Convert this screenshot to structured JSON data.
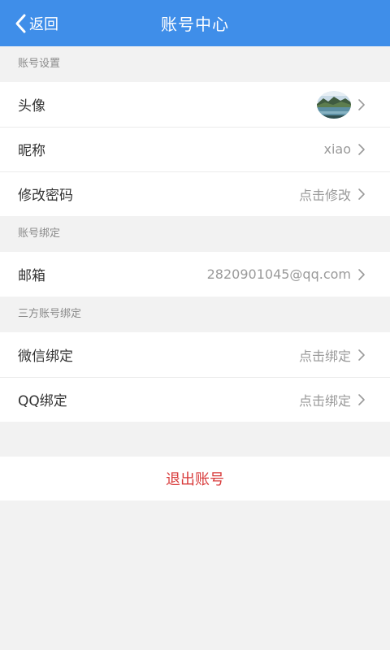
{
  "header": {
    "back_label": "返回",
    "title": "账号中心"
  },
  "colors": {
    "primary": "#3f8ee9",
    "logout": "#d83a3a"
  },
  "sections": {
    "account_settings": {
      "label": "账号设置",
      "rows": [
        {
          "label": "头像",
          "value": "",
          "icon": "avatar-landscape"
        },
        {
          "label": "昵称",
          "value": "xiao"
        },
        {
          "label": "修改密码",
          "value": "点击修改"
        }
      ]
    },
    "account_binding": {
      "label": "账号绑定",
      "rows": [
        {
          "label": "邮箱",
          "value": "2820901045@qq.com"
        }
      ]
    },
    "third_party_binding": {
      "label": "三方账号绑定",
      "rows": [
        {
          "label": "微信绑定",
          "value": "点击绑定"
        },
        {
          "label": "QQ绑定",
          "value": "点击绑定"
        }
      ]
    }
  },
  "logout_label": "退出账号"
}
